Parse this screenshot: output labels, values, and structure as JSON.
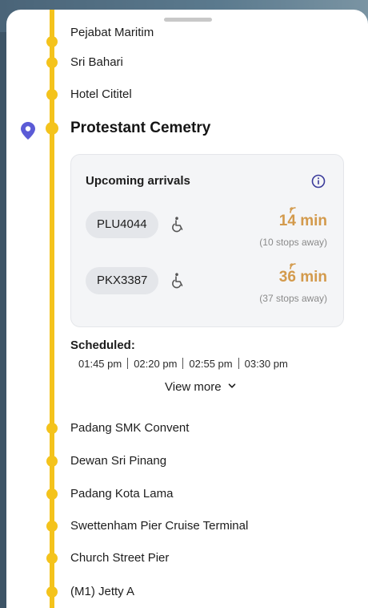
{
  "stops_before": [
    {
      "name": "Pejabat Maritim"
    },
    {
      "name": "Sri Bahari"
    },
    {
      "name": "Hotel Cititel"
    }
  ],
  "current_stop": {
    "name": "Protestant Cemetry"
  },
  "arrivals": {
    "title": "Upcoming arrivals",
    "items": [
      {
        "bus": "PLU4044",
        "eta_value": "14",
        "eta_unit": "min",
        "stops_away": "(10 stops away)"
      },
      {
        "bus": "PKX3387",
        "eta_value": "36",
        "eta_unit": "min",
        "stops_away": "(37 stops away)"
      }
    ]
  },
  "scheduled": {
    "label": "Scheduled:",
    "times": [
      "01:45 pm",
      "02:20 pm",
      "02:55 pm",
      "03:30 pm"
    ],
    "view_more": "View more"
  },
  "stops_after": [
    {
      "name": "Padang SMK Convent"
    },
    {
      "name": "Dewan Sri Pinang"
    },
    {
      "name": "Padang Kota Lama"
    },
    {
      "name": "Swettenham Pier Cruise Terminal"
    },
    {
      "name": "Church Street Pier"
    },
    {
      "name": "(M1) Jetty A"
    }
  ],
  "colors": {
    "route": "#f4c31c",
    "pin": "#5b5bd6",
    "eta": "#d39a4c"
  },
  "icons": {
    "pin": "location-pin-icon",
    "info": "info-icon",
    "wheelchair": "wheelchair-icon",
    "live": "live-signal-icon",
    "chevron": "chevron-down-icon"
  }
}
